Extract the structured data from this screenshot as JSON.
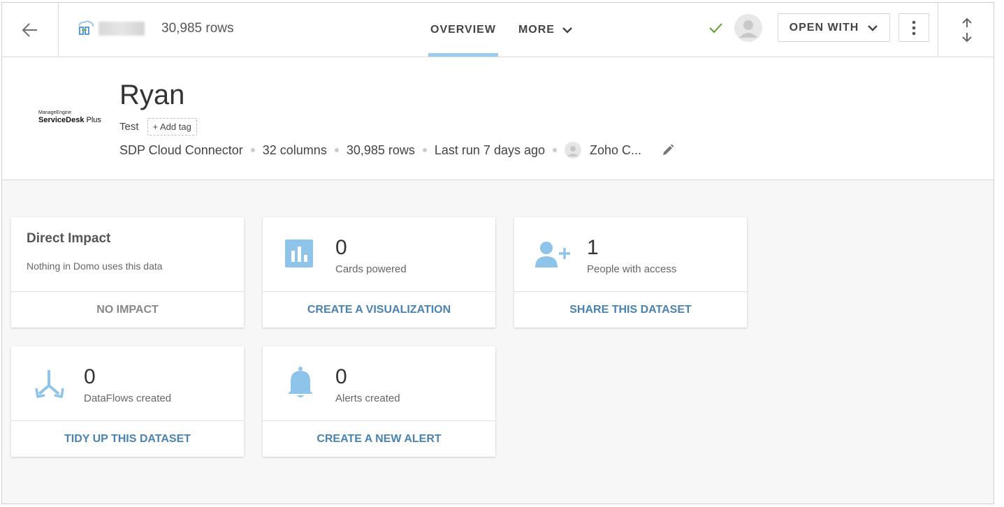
{
  "topbar": {
    "rows_count": "30,985 rows",
    "tabs": [
      {
        "label": "OVERVIEW",
        "active": true
      },
      {
        "label": "MORE",
        "active": false
      }
    ],
    "open_with_label": "OPEN WITH",
    "status_icon": "check-icon"
  },
  "header": {
    "logo": {
      "line1": "ManageEngine",
      "line2_bold": "ServiceDesk",
      "line2_rest": " Plus"
    },
    "title": "Ryan",
    "tag": "Test",
    "add_tag_label": "+ Add tag",
    "meta": {
      "connector": "SDP Cloud Connector",
      "columns": "32 columns",
      "rows": "30,985 rows",
      "last_run": "Last run 7 days ago",
      "owner": "Zoho C..."
    }
  },
  "cards": {
    "direct_impact": {
      "title": "Direct Impact",
      "description": "Nothing in Domo uses this data",
      "action": "NO IMPACT"
    },
    "cards_powered": {
      "count": "0",
      "label": "Cards powered",
      "action": "CREATE A VISUALIZATION",
      "icon": "bar-chart-icon"
    },
    "people_access": {
      "count": "1",
      "label": "People with access",
      "action": "SHARE THIS DATASET",
      "icon": "add-user-icon"
    },
    "dataflows": {
      "count": "0",
      "label": "DataFlows created",
      "action": "TIDY UP THIS DATASET",
      "icon": "dataflow-icon"
    },
    "alerts": {
      "count": "0",
      "label": "Alerts created",
      "action": "CREATE A NEW ALERT",
      "icon": "bell-icon"
    }
  },
  "colors": {
    "accent": "#4a82b0",
    "icon_blue": "#8ec4ea",
    "tab_underline": "#99ccee",
    "check": "#5aa02c"
  }
}
